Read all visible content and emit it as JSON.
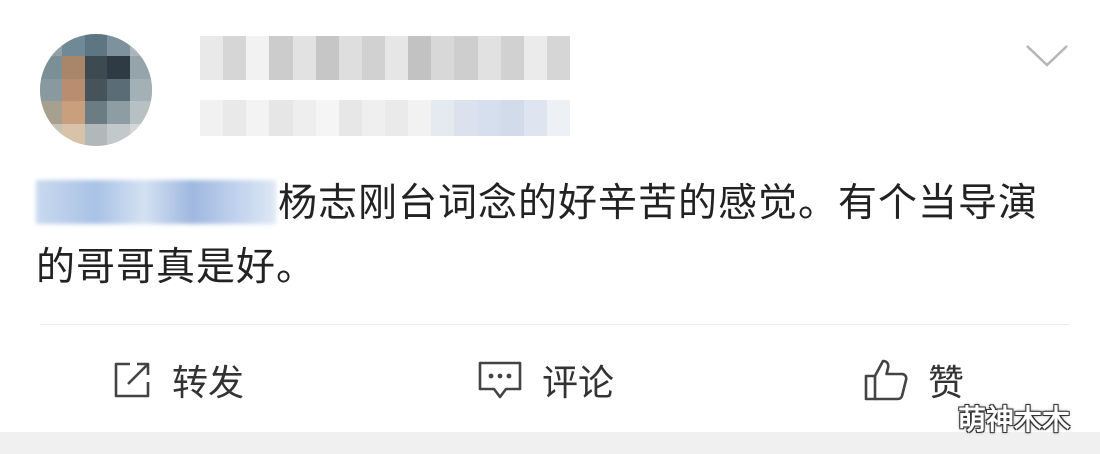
{
  "post": {
    "body_text": "杨志刚台词念的好辛苦的感觉。有个当导演的哥哥真是好。"
  },
  "actions": {
    "repost_label": "转发",
    "comment_label": "评论",
    "like_label": "赞"
  },
  "icons": {
    "more": "chevron-down-icon",
    "repost": "share-square-icon",
    "comment": "speech-bubble-icon",
    "like": "thumbs-up-icon"
  },
  "watermark": {
    "text": "萌神木木"
  },
  "colors": {
    "text": "#222222",
    "action_text": "#333333",
    "icon_stroke": "#444444",
    "divider": "#ececec",
    "mention_blur": "#a9c2e6"
  }
}
